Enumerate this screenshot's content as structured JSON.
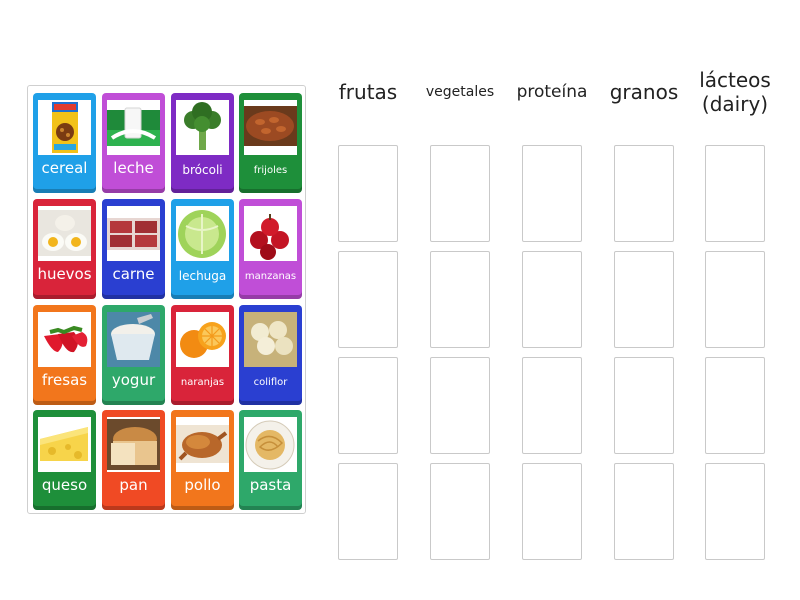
{
  "categories": [
    {
      "label": "frutas",
      "size": "large"
    },
    {
      "label": "vegetales",
      "size": "small"
    },
    {
      "label": "proteína",
      "size": "medium"
    },
    {
      "label": "granos",
      "size": "large"
    },
    {
      "label": "lácteos",
      "label2": "(dairy)",
      "size": "large"
    }
  ],
  "cards": [
    {
      "label": "cereal",
      "color": "#1fa0e8",
      "icon": "cereal-box-icon"
    },
    {
      "label": "leche",
      "color": "#c04ed7",
      "icon": "milk-icon"
    },
    {
      "label": "brócoli",
      "color": "#7e2bc4",
      "icon": "broccoli-icon"
    },
    {
      "label": "frijoles",
      "color": "#1e8f3a",
      "icon": "beans-icon"
    },
    {
      "label": "huevos",
      "color": "#d9243a",
      "icon": "eggs-icon"
    },
    {
      "label": "carne",
      "color": "#2a3fd1",
      "icon": "meat-icon"
    },
    {
      "label": "lechuga",
      "color": "#1fa0e8",
      "icon": "lettuce-icon"
    },
    {
      "label": "manzanas",
      "color": "#c04ed7",
      "icon": "apples-icon"
    },
    {
      "label": "fresas",
      "color": "#f2761c",
      "icon": "strawberries-icon"
    },
    {
      "label": "yogur",
      "color": "#2ea86a",
      "icon": "yogurt-icon"
    },
    {
      "label": "naranjas",
      "color": "#d9243a",
      "icon": "oranges-icon"
    },
    {
      "label": "coliflor",
      "color": "#2a3fd1",
      "icon": "cauliflower-icon"
    },
    {
      "label": "queso",
      "color": "#1e8f3a",
      "icon": "cheese-icon"
    },
    {
      "label": "pan",
      "color": "#f04a24",
      "icon": "bread-icon"
    },
    {
      "label": "pollo",
      "color": "#f2761c",
      "icon": "chicken-icon"
    },
    {
      "label": "pasta",
      "color": "#2ea86a",
      "icon": "pasta-icon"
    }
  ],
  "slots_per_category": 4
}
